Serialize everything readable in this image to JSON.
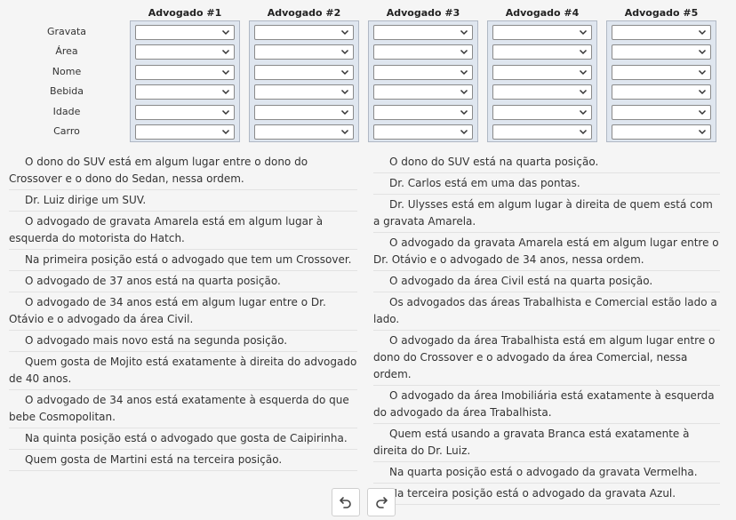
{
  "columns": [
    {
      "title": "Advogado #1"
    },
    {
      "title": "Advogado #2"
    },
    {
      "title": "Advogado #3"
    },
    {
      "title": "Advogado #4"
    },
    {
      "title": "Advogado #5"
    }
  ],
  "rows": [
    "Gravata",
    "Área",
    "Nome",
    "Bebida",
    "Idade",
    "Carro"
  ],
  "selects": {
    "value": ""
  },
  "clues_left": [
    "O dono do SUV está em algum lugar entre o dono do Crossover e o dono do Sedan, nessa ordem.",
    "Dr. Luiz dirige um SUV.",
    "O advogado de gravata Amarela está em algum lugar à esquerda do motorista do Hatch.",
    "Na primeira posição está o advogado que tem um Crossover.",
    "O advogado de 37 anos está na quarta posição.",
    "O advogado de 34 anos está em algum lugar entre o Dr. Otávio e o advogado da área Civil.",
    "O advogado mais novo está na segunda posição.",
    "Quem gosta de Mojito está exatamente à direita do advogado de 40 anos.",
    "O advogado de 34 anos está exatamente à esquerda do que bebe Cosmopolitan.",
    "Na quinta posição está o advogado que gosta de Caipirinha.",
    "Quem gosta de Martini está na terceira posição."
  ],
  "clues_right": [
    "O dono do SUV está na quarta posição.",
    "Dr. Carlos está em uma das pontas.",
    "Dr. Ulysses está em algum lugar à direita de quem está com a gravata Amarela.",
    "O advogado da gravata Amarela está em algum lugar entre o Dr. Otávio e o advogado de 34 anos, nessa ordem.",
    "O advogado da área Civil está na quarta posição.",
    "Os advogados das áreas Trabalhista e Comercial estão lado a lado.",
    "O advogado da área Trabalhista está em algum lugar entre o dono do Crossover e o advogado da área Comercial, nessa ordem.",
    "O advogado da área Imobiliária está exatamente à esquerda do advogado da área Trabalhista.",
    "Quem está usando a gravata Branca está exatamente à direita do Dr. Luiz.",
    "Na quarta posição está o advogado da gravata Vermelha.",
    "Na terceira posição está o advogado da gravata Azul."
  ],
  "controls": {
    "undo_icon": "undo-icon",
    "redo_icon": "redo-icon"
  }
}
